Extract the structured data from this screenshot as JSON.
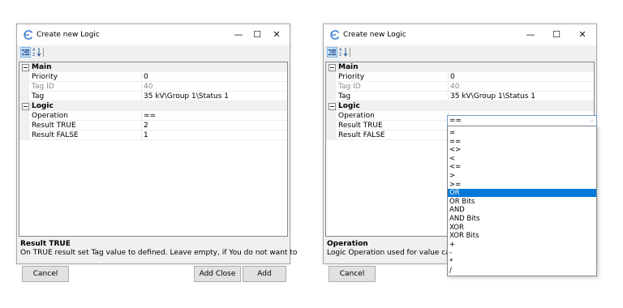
{
  "window_title": "Create new Logic",
  "titlebar_controls": {
    "minimize": "—",
    "maximize": "☐",
    "close": "✕"
  },
  "categories": {
    "main": "Main",
    "logic": "Logic"
  },
  "properties": {
    "priority": {
      "name": "Priority",
      "value": "0"
    },
    "tag_id": {
      "name": "Tag ID",
      "value": "40"
    },
    "tag": {
      "name": "Tag",
      "value": "35 kV\\Group 1\\Status 1"
    },
    "operation": {
      "name": "Operation",
      "value": "=="
    },
    "result_true": {
      "name": "Result TRUE",
      "value": "2"
    },
    "result_false": {
      "name": "Result FALSE",
      "value": "1"
    }
  },
  "left_dialog": {
    "description_title": "Result TRUE",
    "description_text": "On TRUE result set Tag value to defined. Leave empty, if You do not want to",
    "buttons": {
      "cancel": "Cancel",
      "add_close": "Add Close",
      "add": "Add"
    }
  },
  "right_dialog": {
    "description_title": "Operation",
    "description_text": "Logic Operation used for value calcu",
    "buttons": {
      "cancel": "Cancel"
    }
  },
  "operation_dropdown": {
    "selected": "==",
    "highlighted": "OR",
    "options": [
      "=",
      "==",
      "<>",
      "<",
      "<=",
      ">",
      ">=",
      "OR",
      "OR Bits",
      "AND",
      "AND Bits",
      "XOR",
      "XOR Bits",
      "+",
      "-",
      "*",
      "/"
    ]
  },
  "colors": {
    "selection": "#0078d7",
    "window_bg": "#f0f0f0",
    "grid_bg": "#ffffff",
    "button_bg": "#e1e1e1"
  },
  "icons": [
    "app-logo-icon",
    "categorized-view-icon",
    "alphabetical-sort-icon",
    "minimize-icon",
    "maximize-icon",
    "close-icon",
    "collapse-icon",
    "dropdown-arrow-icon"
  ]
}
